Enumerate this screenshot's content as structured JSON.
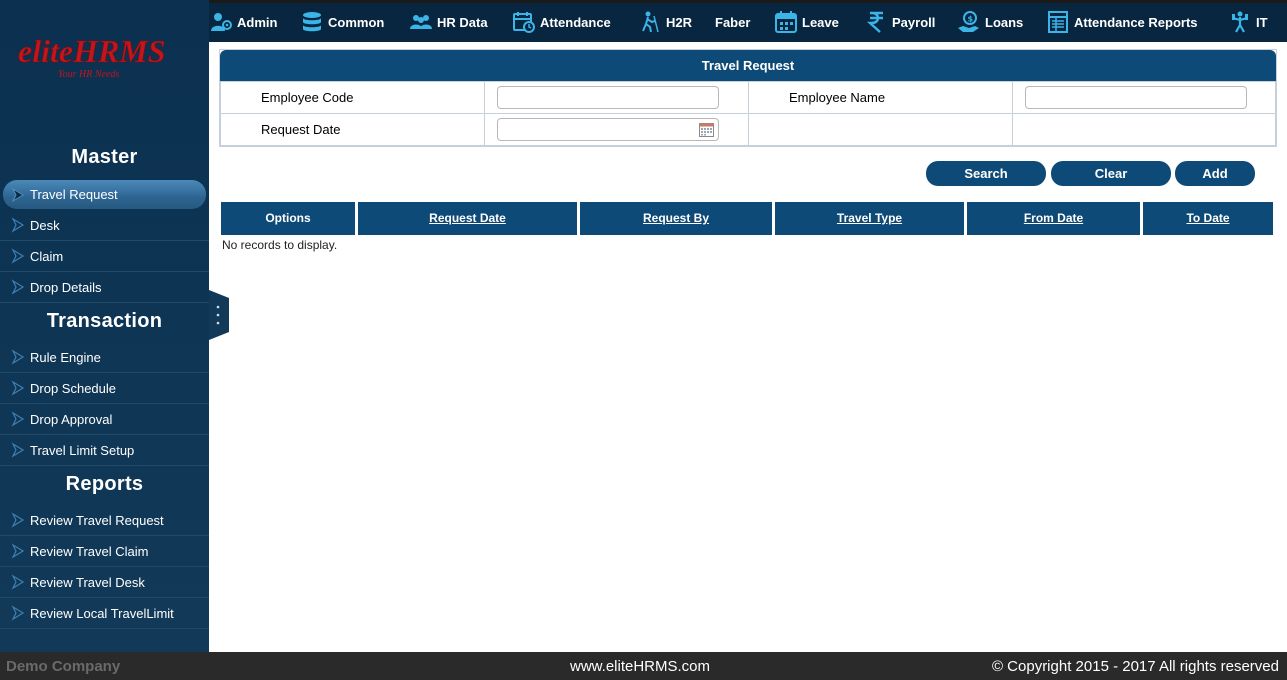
{
  "app": {
    "logo_text": "eliteHRMS",
    "logo_tagline": "Your HR Needs"
  },
  "topnav": [
    {
      "label": "Admin",
      "icon": "admin-icon"
    },
    {
      "label": "Common",
      "icon": "database-icon"
    },
    {
      "label": "HR Data",
      "icon": "people-icon"
    },
    {
      "label": "Attendance",
      "icon": "calendar-clock-icon"
    },
    {
      "label": "H2R",
      "icon": "walker-icon"
    },
    {
      "label": "Faber",
      "icon": ""
    },
    {
      "label": "Leave",
      "icon": "calendar-icon"
    },
    {
      "label": "Payroll",
      "icon": "rupee-icon"
    },
    {
      "label": "Loans",
      "icon": "money-hand-icon"
    },
    {
      "label": "Attendance Reports",
      "icon": "report-icon"
    },
    {
      "label": "IT",
      "icon": "it-icon"
    }
  ],
  "sidebar": {
    "sections": [
      {
        "title": "Master",
        "items": [
          "Travel Request",
          "Desk",
          "Claim",
          "Drop Details"
        ]
      },
      {
        "title": "Transaction",
        "items": [
          "Rule Engine",
          "Drop Schedule",
          "Drop Approval",
          "Travel Limit Setup"
        ]
      },
      {
        "title": "Reports",
        "items": [
          "Review Travel Request",
          "Review Travel Claim",
          "Review Travel Desk",
          "Review Local TravelLimit"
        ]
      }
    ],
    "active_item": "Travel Request"
  },
  "panel": {
    "title": "Travel Request",
    "fields": {
      "employee_code_label": "Employee Code",
      "employee_code_value": "",
      "employee_name_label": "Employee Name",
      "employee_name_value": "",
      "request_date_label": "Request Date",
      "request_date_value": ""
    }
  },
  "buttons": {
    "search": "Search",
    "clear": "Clear",
    "add": "Add"
  },
  "grid": {
    "columns": [
      "Options",
      "Request Date",
      "Request By",
      "Travel Type",
      "From Date",
      "To Date"
    ],
    "empty_message": "No records to display."
  },
  "footer": {
    "company": "Demo Company",
    "website": "www.eliteHRMS.com",
    "copyright": "© Copyright 2015 - 2017 All rights reserved"
  },
  "colors": {
    "primary": "#0e4a78",
    "sidebar": "#0b3050",
    "topbar": "#08263f",
    "logo": "#c0161c",
    "icon": "#3bb4e8"
  }
}
